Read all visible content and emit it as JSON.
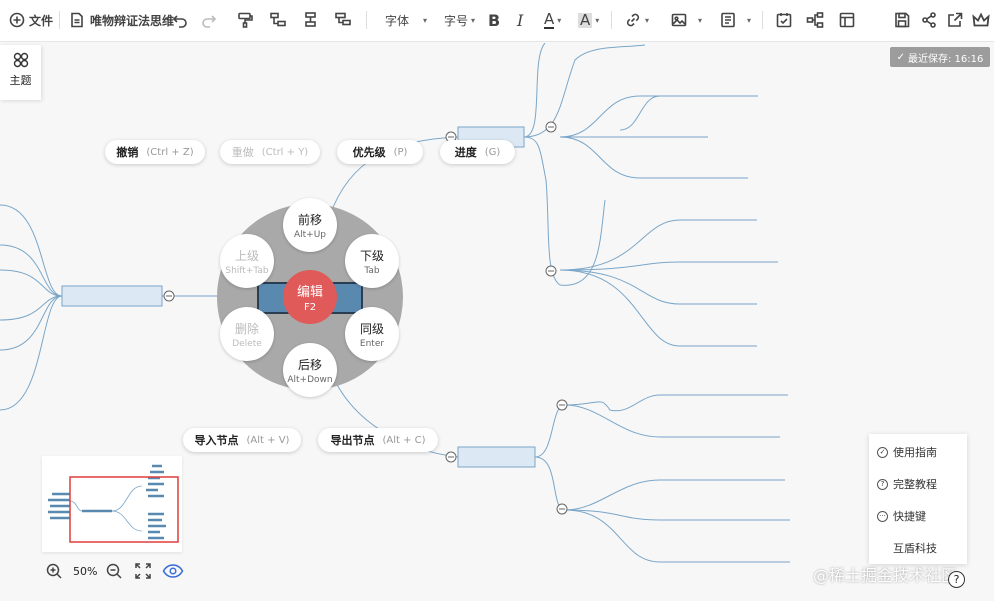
{
  "toolbar": {
    "file_label": "文件",
    "doc_title": "唯物辩证法思维",
    "font_label": "字体",
    "fontsize_label": "字号",
    "bold_label": "B",
    "italic_label": "I",
    "fontcolor_label": "A",
    "highlight_label": "A"
  },
  "theme": {
    "label": "主题"
  },
  "save_status": "最近保存: 16:16",
  "shortcuts": {
    "undo": {
      "label": "撤销",
      "key": "(Ctrl + Z)"
    },
    "redo": {
      "label": "重做",
      "key": "(Ctrl + Y)"
    },
    "priority": {
      "label": "优先级",
      "key": "(P)"
    },
    "progress": {
      "label": "进度",
      "key": "(G)"
    },
    "import": {
      "label": "导入节点",
      "key": "(Alt + V)"
    },
    "export": {
      "label": "导出节点",
      "key": "(Alt + C)"
    }
  },
  "wheel": {
    "up": {
      "label": "前移",
      "key": "Alt+Up"
    },
    "parent": {
      "label": "上级",
      "key": "Shift+Tab"
    },
    "child": {
      "label": "下级",
      "key": "Tab"
    },
    "delete": {
      "label": "删除",
      "key": "Delete"
    },
    "sibling": {
      "label": "同级",
      "key": "Enter"
    },
    "down": {
      "label": "后移",
      "key": "Alt+Down"
    },
    "edit": {
      "label": "编辑",
      "key": "F2"
    }
  },
  "zoom": {
    "level": "50%"
  },
  "help": {
    "guide": "使用指南",
    "tutorial": "完整教程",
    "shortcuts": "快捷键",
    "company": "互盾科技"
  },
  "watermark": "@稀土掘金技术社区",
  "colors": {
    "accent": "#e05a5a",
    "node": "#dce9f4",
    "edge": "#7aa6c8",
    "save_bg": "#9c9c9c"
  }
}
